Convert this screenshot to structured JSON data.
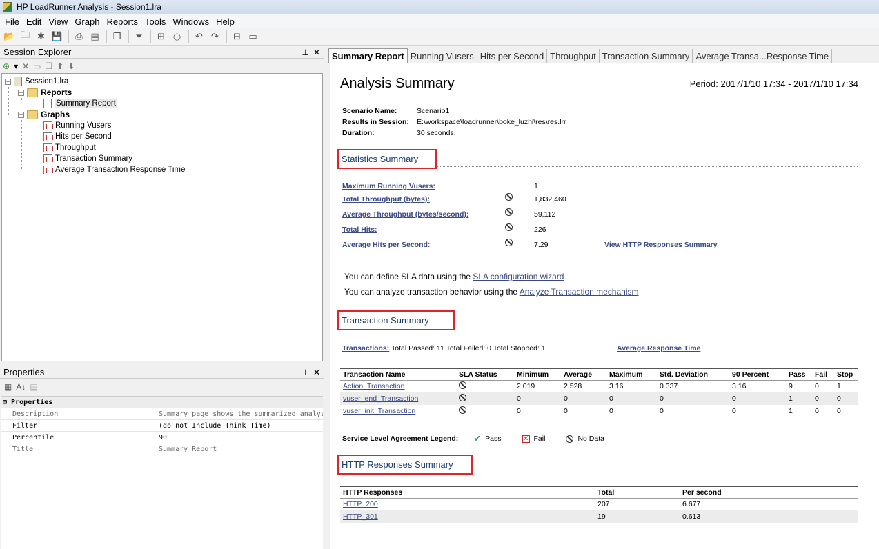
{
  "window": {
    "title": "HP LoadRunner Analysis - Session1.lra"
  },
  "menu": [
    "File",
    "Edit",
    "View",
    "Graph",
    "Reports",
    "Tools",
    "Windows",
    "Help"
  ],
  "toolbar_icons": [
    "open-session-icon",
    "new-session-icon",
    "import-icon",
    "save-icon",
    "print-icon",
    "export-report-icon",
    "copy-graph-icon",
    "filter-icon",
    "cross-result-icon",
    "schedule-icon",
    "undo-icon",
    "redo-icon",
    "sla-icon",
    "outline-icon"
  ],
  "session_explorer": {
    "title": "Session Explorer",
    "root": "Session1.lra",
    "reports_label": "Reports",
    "summary_report": "Summary Report",
    "graphs_label": "Graphs",
    "graphs": [
      "Running Vusers",
      "Hits per Second",
      "Throughput",
      "Transaction Summary",
      "Average Transaction Response Time"
    ]
  },
  "properties": {
    "title": "Properties",
    "category": "Properties",
    "rows": [
      {
        "key": "Description",
        "value": "Summary page shows the summarized analys"
      },
      {
        "key": "Filter",
        "value": "(do not Include Think Time)"
      },
      {
        "key": "Percentile",
        "value": "90"
      },
      {
        "key": "Title",
        "value": "Summary Report"
      }
    ]
  },
  "tabs": [
    "Summary Report",
    "Running Vusers",
    "Hits per Second",
    "Throughput",
    "Transaction Summary",
    "Average Transa...Response Time"
  ],
  "report": {
    "title": "Analysis Summary",
    "period": "Period: 2017/1/10 17:34 - 2017/1/10 17:34",
    "scenario_label": "Scenario Name:",
    "scenario": "Scenario1",
    "results_label": "Results in Session:",
    "results": "E:\\workspace\\loadrunner\\boke_luzhi\\res\\res.lrr",
    "duration_label": "Duration:",
    "duration": "30 seconds.",
    "stats_title": "Statistics Summary",
    "stats": [
      {
        "label": "Maximum Running Vusers:",
        "value": "1"
      },
      {
        "label": "Total Throughput (bytes):",
        "value": "1,832,460"
      },
      {
        "label": "Average Throughput (bytes/second):",
        "value": "59,112"
      },
      {
        "label": "Total Hits:",
        "value": "226"
      },
      {
        "label": "Average Hits per Second:",
        "value": "7.29"
      }
    ],
    "http_summary_link": "View HTTP Responses Summary",
    "sla_line_prefix": "You can define SLA data using the ",
    "sla_link": "SLA configuration wizard",
    "analyze_line_prefix": "You can analyze transaction behavior using the ",
    "analyze_link": "Analyze Transaction mechanism",
    "tx_title": "Transaction Summary",
    "tx_link": "Transactions:",
    "tx_totals": "Total Passed: 11 Total Failed: 0 Total Stopped: 1",
    "avg_rt_link": "Average Response Time",
    "tx_headers": [
      "Transaction Name",
      "SLA Status",
      "Minimum",
      "Average",
      "Maximum",
      "Std. Deviation",
      "90 Percent",
      "Pass",
      "Fail",
      "Stop"
    ],
    "tx_rows": [
      [
        "Action_Transaction",
        "",
        "2.019",
        "2.528",
        "3.16",
        "0.337",
        "3.16",
        "9",
        "0",
        "1"
      ],
      [
        "vuser_end_Transaction",
        "",
        "0",
        "0",
        "0",
        "0",
        "0",
        "1",
        "0",
        "0"
      ],
      [
        "vuser_init_Transaction",
        "",
        "0",
        "0",
        "0",
        "0",
        "0",
        "1",
        "0",
        "0"
      ]
    ],
    "legend_label": "Service Level Agreement Legend:",
    "legend_pass": "Pass",
    "legend_fail": "Fail",
    "legend_nodata": "No Data",
    "http_title": "HTTP Responses Summary",
    "http_headers": [
      "HTTP Responses",
      "Total",
      "Per second"
    ],
    "http_rows": [
      [
        "HTTP_200",
        "207",
        "6.677"
      ],
      [
        "HTTP_301",
        "19",
        "0.613"
      ]
    ]
  }
}
